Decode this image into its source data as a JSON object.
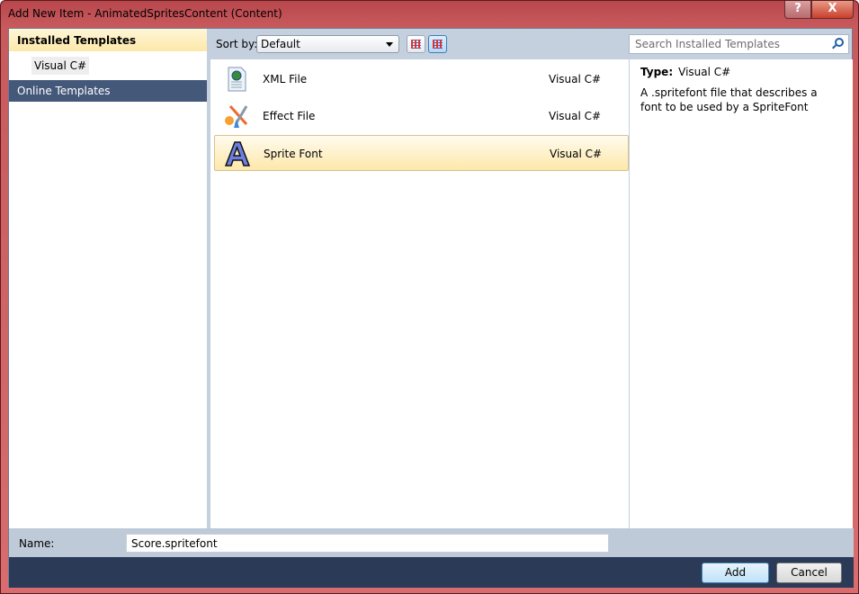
{
  "window": {
    "title": "Add New Item - AnimatedSpritesContent (Content)",
    "help": "?",
    "close": "X"
  },
  "sidebar": {
    "installed": "Installed Templates",
    "child": "Visual C#",
    "online": "Online Templates"
  },
  "toolbar": {
    "sort_label": "Sort by:",
    "sort_value": "Default",
    "search_placeholder": "Search Installed Templates"
  },
  "templates": [
    {
      "name": "XML File",
      "lang": "Visual C#",
      "icon": "xml-file-icon"
    },
    {
      "name": "Effect File",
      "lang": "Visual C#",
      "icon": "effect-file-icon"
    },
    {
      "name": "Sprite Font",
      "lang": "Visual C#",
      "icon": "sprite-font-icon",
      "selected": true
    }
  ],
  "details": {
    "type_label": "Type:",
    "type_value": "Visual C#",
    "description": "A .spritefont file that describes a font to be used by a SpriteFont"
  },
  "name_field": {
    "label": "Name:",
    "value": "Score.spritefont"
  },
  "buttons": {
    "add": "Add",
    "cancel": "Cancel"
  },
  "colors": {
    "accent_selection": "#fde8aa",
    "sidebar_selected": "#44587a",
    "bottom_bar": "#2b3a57"
  }
}
